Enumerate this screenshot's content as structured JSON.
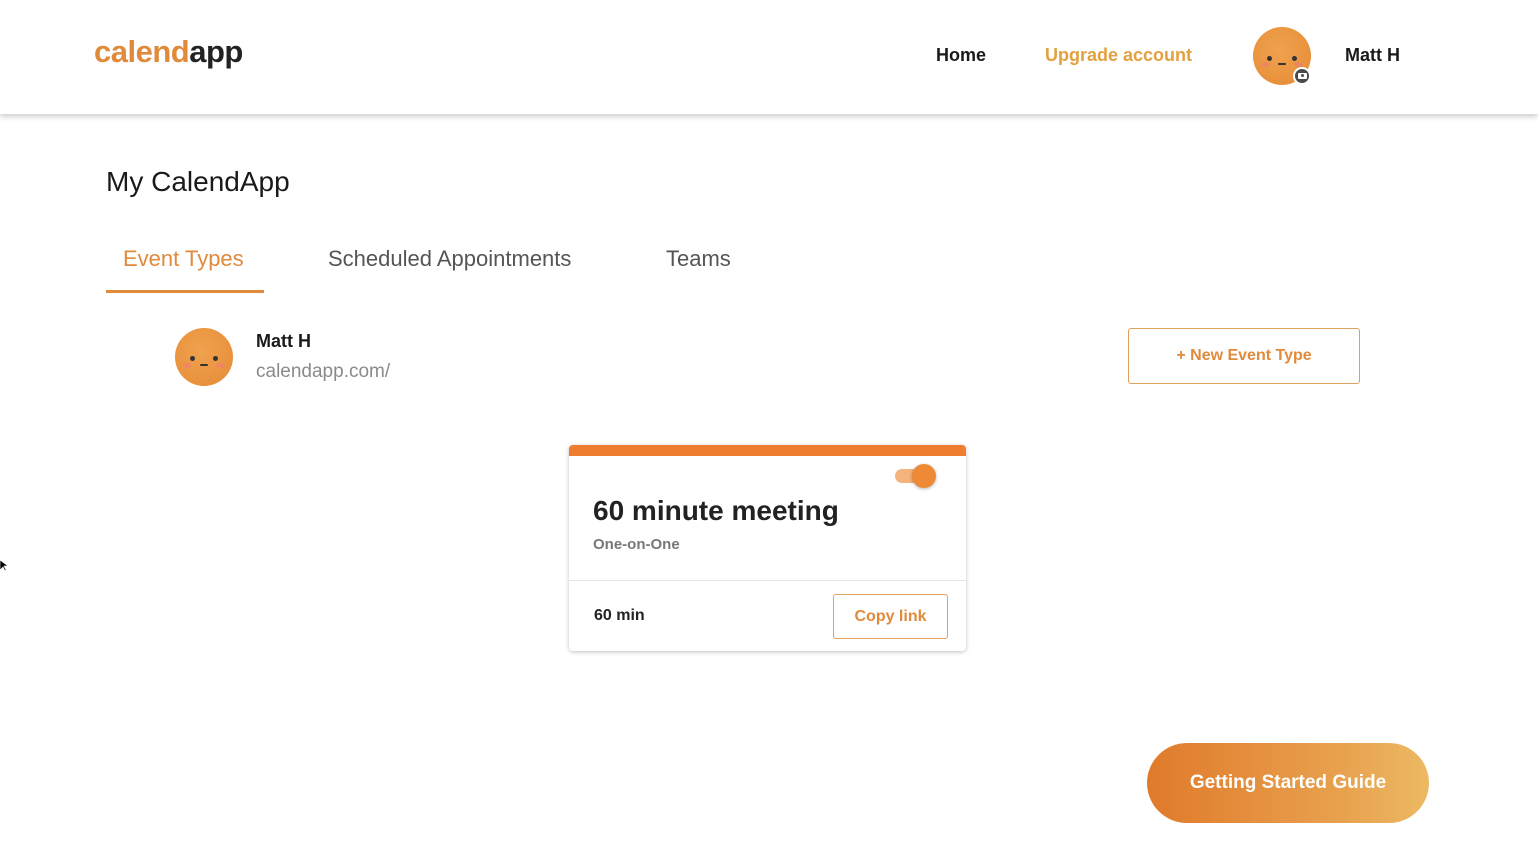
{
  "header": {
    "logo_part1": "calend",
    "logo_part2": "app",
    "nav_home": "Home",
    "nav_upgrade": "Upgrade account",
    "user_name": "Matt H",
    "avatar_icon": "smiley-avatar-icon",
    "camera_icon": "camera-icon"
  },
  "page": {
    "title": "My CalendApp",
    "tabs": [
      {
        "label": "Event Types",
        "active": true
      },
      {
        "label": "Scheduled Appointments",
        "active": false
      },
      {
        "label": "Teams",
        "active": false
      }
    ]
  },
  "profile": {
    "name": "Matt H",
    "url": "calendapp.com/",
    "new_event_label": "+ New Event Type"
  },
  "event_card": {
    "title": "60 minute meeting",
    "subtitle": "One-on-One",
    "duration": "60 min",
    "copy_label": "Copy link",
    "enabled": true
  },
  "guide_button": "Getting Started Guide",
  "colors": {
    "accent": "#e08a3c",
    "upgrade": "#e3a040",
    "card_bar": "#ef7d2f"
  }
}
